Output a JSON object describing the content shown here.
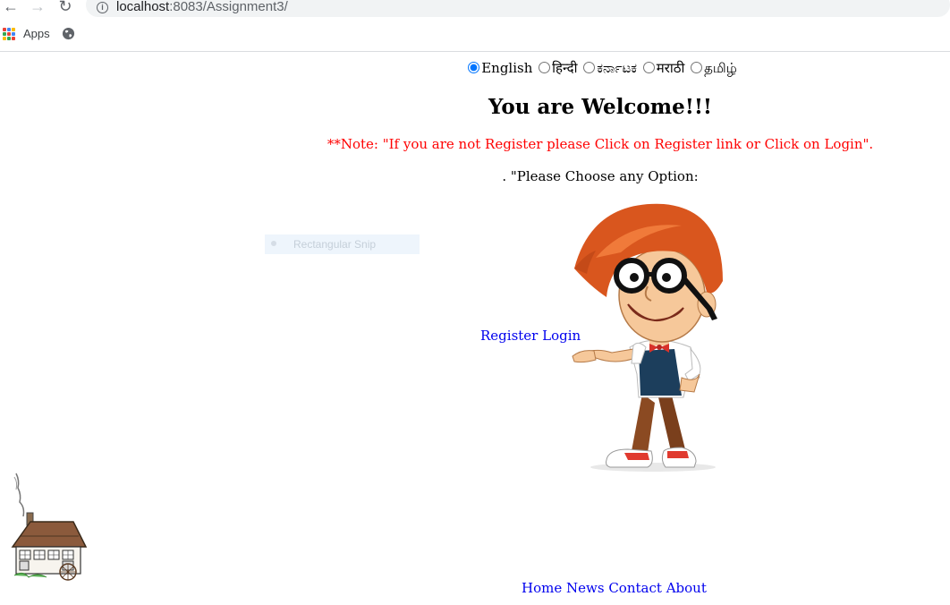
{
  "browser": {
    "url_host": "localhost",
    "url_path": ":8083/Assignment3/",
    "bookmarks": [
      {
        "label": "Apps",
        "icon": "apps-grid-icon"
      }
    ],
    "bookmark_globe_icon": "globe-icon"
  },
  "languages": {
    "selected": "English",
    "options": [
      {
        "label": "English",
        "checked": true
      },
      {
        "label": "हिन्दी",
        "checked": false
      },
      {
        "label": "ಕರ್ನಾಟಕ",
        "checked": false
      },
      {
        "label": "मराठी",
        "checked": false
      },
      {
        "label": "தமிழ்",
        "checked": false
      }
    ]
  },
  "main": {
    "title": "You are Welcome!!!",
    "note": "**Note: \"If you are not Register please Click on Register link or Click on Login\".",
    "choose_prompt": ". \"Please Choose any Option:",
    "register_link": "Register",
    "login_link": "Login"
  },
  "overlay": {
    "snip_label": "Rectangular Snip"
  },
  "footer": {
    "links": [
      "Home",
      "News",
      "Contact",
      "About"
    ]
  },
  "colors": {
    "note_red": "#ff0000",
    "link_blue": "#0000ee"
  }
}
